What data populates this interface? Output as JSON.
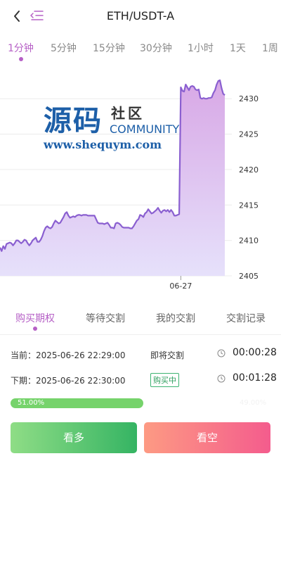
{
  "header": {
    "title": "ETH/USDT-A"
  },
  "timeframes": [
    {
      "label": "1分钟",
      "active": true
    },
    {
      "label": "5分钟"
    },
    {
      "label": "15分钟"
    },
    {
      "label": "30分钟"
    },
    {
      "label": "1小时"
    },
    {
      "label": "1天"
    },
    {
      "label": "1周"
    }
  ],
  "watermark": {
    "big": "源码",
    "small": "社区",
    "community": "COMMUNITY",
    "url": "www.shequym.com"
  },
  "chart_data": {
    "type": "area",
    "ylim": [
      2405,
      2433
    ],
    "yticks": [
      2405,
      2410,
      2415,
      2420,
      2425,
      2430
    ],
    "x_date_label": "06-27",
    "line_color": "#8a5fd0",
    "fill_top": "#d8a8e6",
    "fill_bottom": "#e6e1fb",
    "values": [
      2409.0,
      2408.5,
      2409.2,
      2408.8,
      2409.5,
      2409.6,
      2409.7,
      2409.6,
      2409.3,
      2409.6,
      2410.0,
      2410.0,
      2409.8,
      2409.6,
      2409.8,
      2410.1,
      2410.0,
      2409.6,
      2409.3,
      2409.6,
      2410.0,
      2410.2,
      2410.4,
      2409.8,
      2409.8,
      2410.1,
      2410.6,
      2411.3,
      2411.8,
      2412.0,
      2411.8,
      2411.7,
      2411.9,
      2412.4,
      2412.8,
      2412.6,
      2412.4,
      2412.5,
      2412.9,
      2413.3,
      2413.8,
      2414.0,
      2413.5,
      2413.2,
      2413.3,
      2413.4,
      2413.3,
      2413.5,
      2413.6,
      2413.6,
      2413.5,
      2413.6,
      2413.6,
      2413.6,
      2413.5,
      2413.5,
      2413.5,
      2413.5,
      2413.5,
      2413.0,
      2412.5,
      2412.4,
      2412.4,
      2412.4,
      2412.3,
      2412.4,
      2412.5,
      2412.2,
      2411.8,
      2411.8,
      2411.7,
      2412.4,
      2412.5,
      2412.4,
      2412.2,
      2411.9,
      2411.8,
      2411.8,
      2411.8,
      2411.8,
      2411.7,
      2411.7,
      2412.0,
      2412.4,
      2412.8,
      2413.0,
      2413.6,
      2413.5,
      2413.3,
      2413.8,
      2414.0,
      2414.4,
      2414.1,
      2413.8,
      2413.9,
      2414.1,
      2414.3,
      2414.6,
      2414.2,
      2413.9,
      2414.2,
      2414.3,
      2414.1,
      2414.3,
      2414.0,
      2414.3,
      2414.0,
      2413.5,
      2413.5,
      2413.6,
      2413.7,
      2431.6,
      2431.1,
      2431.0,
      2432.0,
      2431.6,
      2431.2,
      2431.7,
      2431.8,
      2431.7,
      2431.3,
      2431.2,
      2431.3,
      2430.1,
      2430.0,
      2430.1,
      2430.0,
      2430.0,
      2430.1,
      2430.1,
      2430.2,
      2430.8,
      2431.2,
      2432.0,
      2432.5,
      2432.6,
      2431.5,
      2430.7,
      2430.5
    ]
  },
  "tabs": [
    {
      "label": "购买期权",
      "active": true
    },
    {
      "label": "等待交割"
    },
    {
      "label": "我的交割"
    },
    {
      "label": "交割记录"
    }
  ],
  "periods": {
    "current": {
      "label": "当前：2025-06-26 22:29:00",
      "status": "即将交割",
      "countdown": "00:00:28"
    },
    "next": {
      "label": "下期：2025-06-26 22:30:00",
      "status": "购买中",
      "countdown": "00:01:28"
    }
  },
  "ratio": {
    "up_label": "51.00%",
    "up_fraction": 0.51,
    "down_label": "49.00%"
  },
  "buttons": {
    "long": "看多",
    "short": "看空"
  },
  "colors": {
    "accent": "#b660c6",
    "up": "#35b463",
    "down": "#f45c8d"
  }
}
